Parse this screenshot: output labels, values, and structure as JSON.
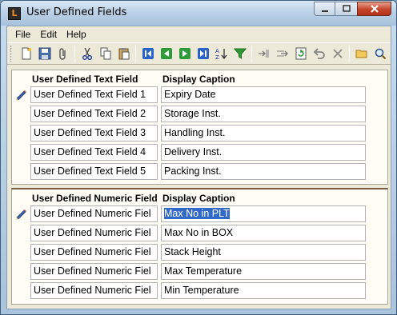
{
  "window": {
    "title": "User Defined Fields"
  },
  "menu": [
    "File",
    "Edit",
    "Help"
  ],
  "toolbar": {
    "groups": [
      [
        "new-icon",
        "save-icon",
        "attach-icon"
      ],
      [
        "cut-icon",
        "copy-icon",
        "paste-icon"
      ],
      [
        "first-record-icon",
        "previous-record-icon",
        "next-record-icon",
        "last-record-icon",
        "sort-icon",
        "filter-icon"
      ],
      [
        "insert-icon",
        "append-icon",
        "refresh-icon",
        "undo-icon",
        "delete-icon"
      ],
      [
        "open-folder-icon",
        "search-icon"
      ]
    ]
  },
  "text_fields": {
    "col_field": "User Defined Text Field",
    "col_caption": "Display Caption",
    "rows": [
      {
        "field": "User Defined Text Field 1",
        "caption": "Expiry Date"
      },
      {
        "field": "User Defined Text Field 2",
        "caption": "Storage Inst."
      },
      {
        "field": "User Defined Text Field 3",
        "caption": "Handling Inst."
      },
      {
        "field": "User Defined Text Field 4",
        "caption": "Delivery Inst."
      },
      {
        "field": "User Defined Text Field 5",
        "caption": "Packing Inst."
      }
    ]
  },
  "numeric_fields": {
    "col_field": "User Defined Numeric Field",
    "col_caption": "Display Caption",
    "rows": [
      {
        "field": "User Defined Numeric Fiel",
        "caption": "Max No in PLT"
      },
      {
        "field": "User Defined Numeric Fiel",
        "caption": "Max No in BOX"
      },
      {
        "field": "User Defined Numeric Fiel",
        "caption": "Stack Height"
      },
      {
        "field": "User Defined Numeric Fiel",
        "caption": "Max Temperature"
      },
      {
        "field": "User Defined Numeric Fiel",
        "caption": "Min Temperature"
      }
    ]
  },
  "colors": {
    "selection": "#3169c6",
    "panel_bg": "#fffdf5",
    "chrome": "#ece9d8"
  }
}
